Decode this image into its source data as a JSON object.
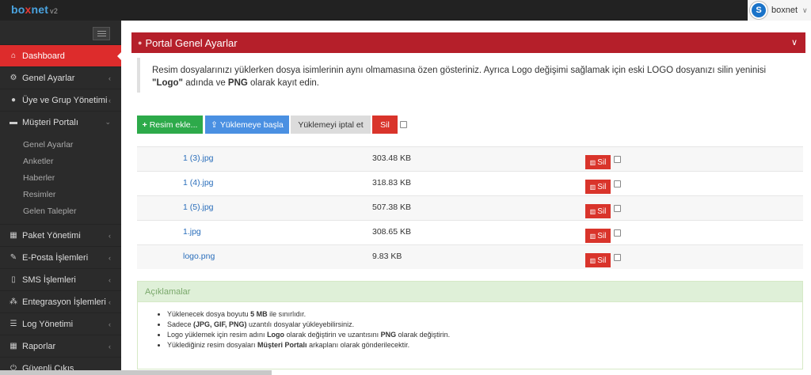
{
  "topbar": {
    "logo": {
      "part1": "bo",
      "part2": "x",
      "part3": "net",
      "version": "v2"
    },
    "user": {
      "name": "boxnet",
      "avatar_letter": "S"
    }
  },
  "sidebar": {
    "items": [
      {
        "label": "Dashboard",
        "icon": "home-icon",
        "glyph": "⌂",
        "active": true
      },
      {
        "label": "Genel Ayarlar",
        "icon": "cogs-icon",
        "glyph": "⚙",
        "arrow": "‹"
      },
      {
        "label": "Üye ve Grup Yönetimi",
        "icon": "user-icon",
        "glyph": "●",
        "arrow": "‹"
      },
      {
        "label": "Müşteri Portalı",
        "icon": "folder-open-icon",
        "glyph": "▬",
        "arrow": "⌄"
      }
    ],
    "submenu": [
      "Genel Ayarlar",
      "Anketler",
      "Haberler",
      "Resimler",
      "Gelen Talepler"
    ],
    "items2": [
      {
        "label": "Paket Yönetimi",
        "icon": "table-icon",
        "glyph": "▦",
        "arrow": "‹"
      },
      {
        "label": "E-Posta İşlemleri",
        "icon": "edit-icon",
        "glyph": "✎",
        "arrow": "‹"
      },
      {
        "label": "SMS İşlemleri",
        "icon": "mobile-icon",
        "glyph": "▯",
        "arrow": "‹"
      },
      {
        "label": "Entegrasyon İşlemleri",
        "icon": "sitemap-icon",
        "glyph": "⁂",
        "arrow": "‹"
      },
      {
        "label": "Log Yönetimi",
        "icon": "tasks-icon",
        "glyph": "☰",
        "arrow": "‹"
      },
      {
        "label": "Raporlar",
        "icon": "th-icon",
        "glyph": "▦",
        "arrow": "‹"
      },
      {
        "label": "Güvenli Çıkış",
        "icon": "power-icon",
        "glyph": "⏻"
      }
    ]
  },
  "panel": {
    "title": "Portal Genel Ayarlar",
    "notice": {
      "text1": "Resim dosyalarınızı yüklerken dosya isimlerinin aynı olmamasına özen gösteriniz. Ayrıca Logo değişimi sağlamak için eski LOGO dosyanızı silin yeninisi",
      "bold1": "\"Logo\"",
      "text2": " adında ve ",
      "bold2": "PNG",
      "text3": " olarak kayıt edin."
    }
  },
  "toolbar": {
    "add": "Resim ekle...",
    "upload": "Yüklemeye başla",
    "cancel": "Yüklemeyi iptal et",
    "delete": "Sil"
  },
  "files": [
    {
      "name": "1 (3).jpg",
      "size": "303.48 KB",
      "delete": "Sil"
    },
    {
      "name": "1 (4).jpg",
      "size": "318.83 KB",
      "delete": "Sil"
    },
    {
      "name": "1 (5).jpg",
      "size": "507.38 KB",
      "delete": "Sil"
    },
    {
      "name": "1.jpg",
      "size": "308.65 KB",
      "delete": "Sil"
    },
    {
      "name": "logo.png",
      "size": "9.83 KB",
      "delete": "Sil"
    }
  ],
  "info": {
    "title": "Açıklamalar",
    "lines": [
      {
        "a": "Yüklenecek dosya boyutu ",
        "b": "5 MB",
        "c": " ile sınırlıdır.",
        "d": "",
        "e": "",
        "f": ""
      },
      {
        "a": "Sadece ",
        "b": "(JPG, GIF, PNG)",
        "c": " uzantılı dosyalar yükleyebilirsiniz.",
        "d": "",
        "e": "",
        "f": ""
      },
      {
        "a": "Logo yüklemek için resim adını ",
        "b": "Logo",
        "c": " olarak değiştirin ve uzantısını ",
        "d": "PNG",
        "e": " olarak değiştirin.",
        "f": ""
      },
      {
        "a": "Yüklediğiniz resim dosyaları ",
        "b": "Müşteri Portalı",
        "c": " arkaplanı olarak gönderilecektir.",
        "d": "",
        "e": "",
        "f": ""
      }
    ]
  }
}
